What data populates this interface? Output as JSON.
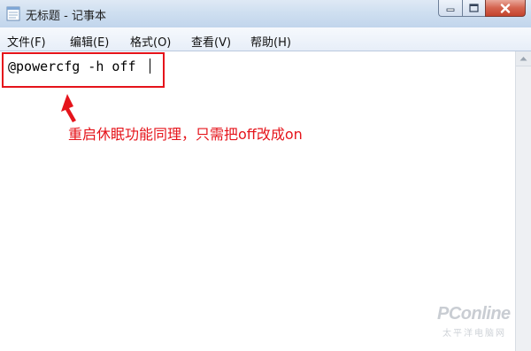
{
  "window": {
    "title": "无标题 - 记事本",
    "icon": "notepad-icon",
    "buttons": [
      "minimize-icon",
      "maximize-icon",
      "close-icon"
    ]
  },
  "menubar": {
    "items": [
      {
        "label": "文件(F)"
      },
      {
        "label": "编辑(E)"
      },
      {
        "label": "格式(O)"
      },
      {
        "label": "查看(V)"
      },
      {
        "label": "帮助(H)"
      }
    ]
  },
  "editor": {
    "text": "@powercfg -h off"
  },
  "annotation": {
    "text": "重启休眠功能同理，只需把off改成on",
    "color": "#e5141b"
  },
  "watermark": {
    "text": "PConline",
    "subtext": "太平洋电脑网"
  }
}
